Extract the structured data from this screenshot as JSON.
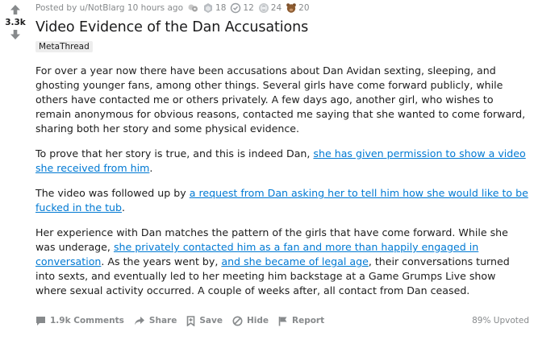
{
  "post": {
    "score": "3.3k",
    "author_line": "Posted by u/NotBlarg 10 hours ago",
    "awards": [
      {
        "name": "hugz-award",
        "count": ""
      },
      {
        "name": "silver-award",
        "count": "18"
      },
      {
        "name": "helpful-award",
        "count": "12"
      },
      {
        "name": "coin-award",
        "count": "24"
      },
      {
        "name": "bear-award",
        "count": "20"
      }
    ],
    "title": "Video Evidence of the Dan Accusations",
    "flair": "MetaThread",
    "body": {
      "p1": "For over a year now there have been accusations about Dan Avidan sexting, sleeping, and ghosting younger fans, among other things. Several girls have come forward publicly, while others have contacted me or others privately. A few days ago, another girl, who wishes to remain anonymous for obvious reasons, contacted me saying that she wanted to come forward, sharing both her story and some physical evidence.",
      "p2_text": "To prove that her story is true, and this is indeed Dan, ",
      "p2_link": "she has given permission to show a video she received from him",
      "p2_end": ".",
      "p3_text": "The video was followed up by ",
      "p3_link": "a request from Dan asking her to tell him how she would like to be fucked in the tub",
      "p3_end": ".",
      "p4_text1": "Her experience with Dan matches the pattern of the girls that have come forward. While she was underage, ",
      "p4_link1": "she privately contacted him as a fan and more than happily engaged in conversation",
      "p4_text2": ". As the years went by, ",
      "p4_link2": "and she became of legal age",
      "p4_text3": ", their conversations turned into sexts, and eventually led to her meeting him backstage at a Game Grumps Live show where sexual activity occurred. A couple of weeks after, all contact from Dan ceased."
    },
    "actions": {
      "comments": "1.9k Comments",
      "share": "Share",
      "save": "Save",
      "hide": "Hide",
      "report": "Report"
    },
    "upvoted": "89% Upvoted"
  }
}
